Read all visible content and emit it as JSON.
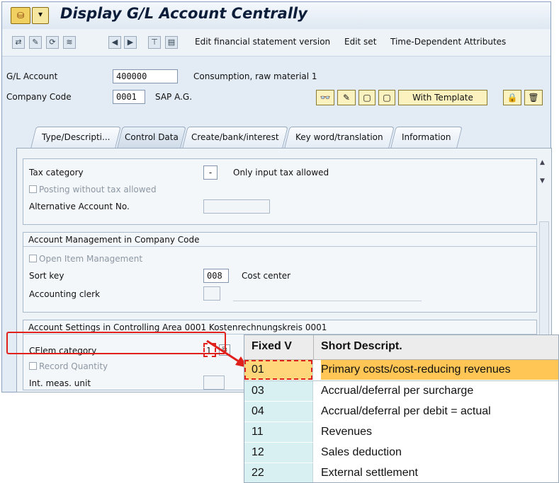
{
  "title": "Display G/L Account Centrally",
  "toolbar": {
    "edit_fsv": "Edit financial statement version",
    "edit_set": "Edit set",
    "time_dep": "Time-Dependent Attributes"
  },
  "header": {
    "gl_label": "G/L Account",
    "gl_value": "400000",
    "gl_desc": "Consumption, raw material 1",
    "cc_label": "Company Code",
    "cc_value": "0001",
    "cc_desc": "SAP A.G.",
    "with_template": "With Template"
  },
  "tabs": [
    "Type/Descripti...",
    "Control Data",
    "Create/bank/interest",
    "Key word/translation",
    "Information"
  ],
  "tax": {
    "tax_category_label": "Tax category",
    "tax_category_value": "-",
    "tax_category_desc": "Only input tax allowed",
    "posting_without_tax": "Posting without tax allowed",
    "alt_account_label": "Alternative Account No."
  },
  "acct_mgmt": {
    "heading": "Account Management in Company Code",
    "open_item": "Open Item Management",
    "sort_key_label": "Sort key",
    "sort_key_value": "008",
    "sort_key_desc": "Cost center",
    "accounting_clerk_label": "Accounting clerk"
  },
  "controlling": {
    "heading": "Account Settings in Controlling Area 0001 Kostenrechnungskreis 0001",
    "celem_label": "CElem category",
    "celem_value": "1",
    "record_quantity": "Record Quantity",
    "int_meas_unit": "Int. meas. unit"
  },
  "dropdown": {
    "col_fixed": "Fixed V",
    "col_desc": "Short Descript.",
    "rows": [
      {
        "code": "01",
        "desc": "Primary costs/cost-reducing revenues"
      },
      {
        "code": "03",
        "desc": "Accrual/deferral per surcharge"
      },
      {
        "code": "04",
        "desc": "Accrual/deferral per debit = actual"
      },
      {
        "code": "11",
        "desc": "Revenues"
      },
      {
        "code": "12",
        "desc": "Sales deduction"
      },
      {
        "code": "22",
        "desc": "External settlement"
      }
    ]
  },
  "colors": {
    "highlight_red": "#e0201b",
    "selected_row": "#ffc555",
    "code_column": "#d9f0f3"
  }
}
